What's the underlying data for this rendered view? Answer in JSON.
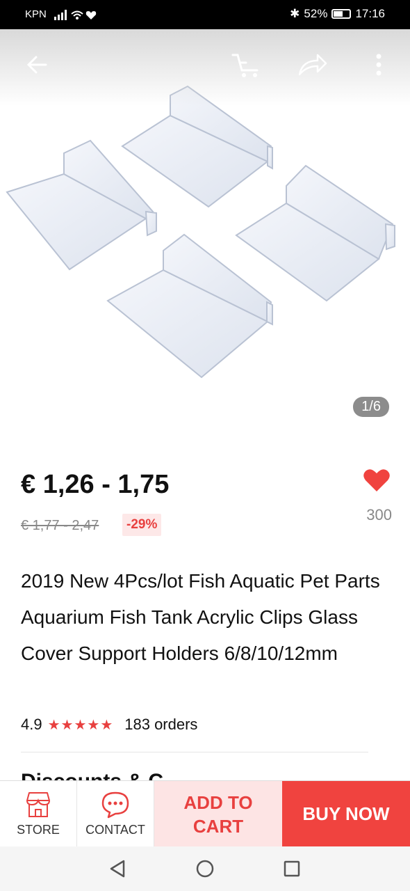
{
  "status": {
    "carrier": "KPN",
    "battery": "52%",
    "time": "17:16",
    "battery_level": 0.52
  },
  "gallery": {
    "counter": "1/6"
  },
  "product": {
    "price": "€ 1,26 - 1,75",
    "original_price": "€ 1,77 - 2,47",
    "discount": "-29%",
    "wishlist_count": "300",
    "title": "2019 New 4Pcs/lot Fish Aquatic Pet Parts Aquarium Fish Tank Acrylic Clips Glass Cover Support Holders 6/8/10/12mm",
    "rating": "4.9",
    "stars": "★★★★★",
    "orders": "183 orders",
    "next_section": "Discounts & C"
  },
  "actions": {
    "store": "STORE",
    "contact": "CONTACT",
    "add_to_cart": "ADD TO CART",
    "buy_now": "BUY NOW"
  },
  "colors": {
    "accent": "#f0433f",
    "cart_bg": "#fde4e4"
  }
}
